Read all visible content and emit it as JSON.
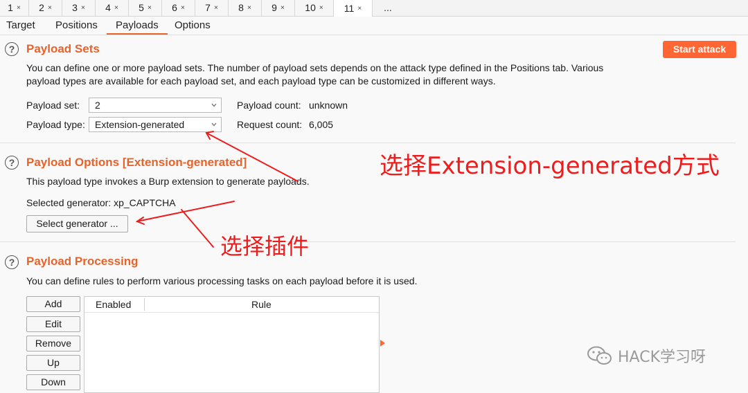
{
  "numbered_tabs": [
    "1",
    "2",
    "3",
    "4",
    "5",
    "6",
    "7",
    "8",
    "9",
    "10",
    "11"
  ],
  "tab_close_glyph": "×",
  "tab_more": "...",
  "active_numbered_tab": "11",
  "subtabs": [
    "Target",
    "Positions",
    "Payloads",
    "Options"
  ],
  "active_subtab": "Payloads",
  "start_attack": "Start attack",
  "help_glyph": "?",
  "payload_sets": {
    "title": "Payload Sets",
    "description_line1": "You can define one or more payload sets. The number of payload sets depends on the attack type defined in the Positions tab. Various",
    "description_line2": "payload types are available for each payload set, and each payload type can be customized in different ways.",
    "set_label": "Payload set:",
    "set_value": "2",
    "type_label": "Payload type:",
    "type_value": "Extension-generated",
    "count_label": "Payload count:",
    "count_value": "unknown",
    "request_label": "Request count:",
    "request_value": "6,005"
  },
  "payload_options": {
    "title": "Payload Options [Extension-generated]",
    "description": "This payload type invokes a Burp extension to generate payloads.",
    "selected_generator": "Selected generator: xp_CAPTCHA",
    "select_button": "Select generator ..."
  },
  "payload_processing": {
    "title": "Payload Processing",
    "description": "You can define rules to perform various processing tasks on each payload before it is used.",
    "buttons": [
      "Add",
      "Edit",
      "Remove",
      "Up",
      "Down"
    ],
    "columns": [
      "Enabled",
      "Rule"
    ]
  },
  "annotations": {
    "extension": "选择Extension-generated方式",
    "plugin": "选择插件"
  },
  "watermark": "HACK学习呀",
  "colors": {
    "accent": "#e8632b",
    "start_button": "#ff6633",
    "annotation": "#ee1c1c"
  }
}
